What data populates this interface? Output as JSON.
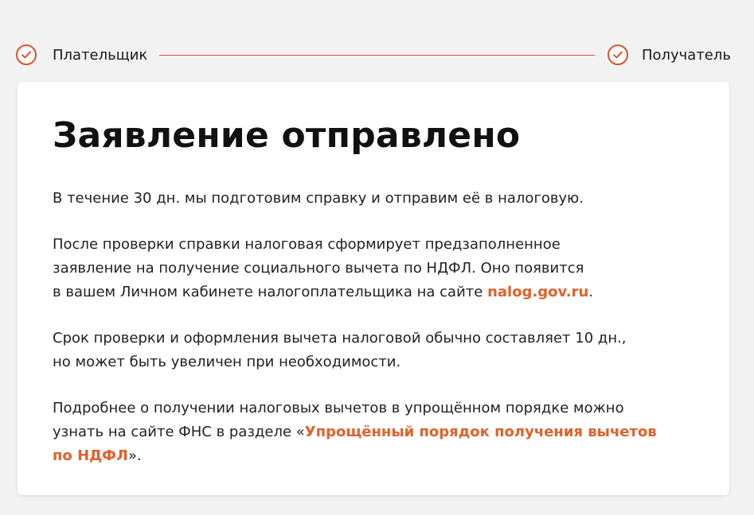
{
  "stepper": {
    "step1_label": "Плательщик",
    "step2_label": "Получатель",
    "accent_color": "#d9532c"
  },
  "card": {
    "title": "Заявление отправлено",
    "p1": "В течение 30 дн. мы подготовим справку и отправим её в налоговую.",
    "p2_line1": "После проверки справки налоговая сформирует предзаполненное",
    "p2_line2": "заявление на получение социального вычета по НДФЛ. Оно появится",
    "p2_line3_before": "в вашем Личном кабинете налогоплательщика на сайте ",
    "p2_link": "nalog.gov.ru",
    "p2_after": ".",
    "p3_line1": "Срок проверки и оформления вычета налоговой обычно составляет 10 дн.,",
    "p3_line2": "но может быть увеличен при необходимости.",
    "p4_line1": "Подробнее о получении налоговых вычетов в упрощённом порядке можно",
    "p4_line2_before": "узнать на сайте ФНС в разделе «",
    "p4_link_line1": "Упрощённый порядок получения вычетов",
    "p4_link_line2": "по НДФЛ",
    "p4_after": "».",
    "link_color": "#e0622a"
  },
  "icons": {
    "step1": "check-circle-icon",
    "step2": "check-circle-icon"
  }
}
